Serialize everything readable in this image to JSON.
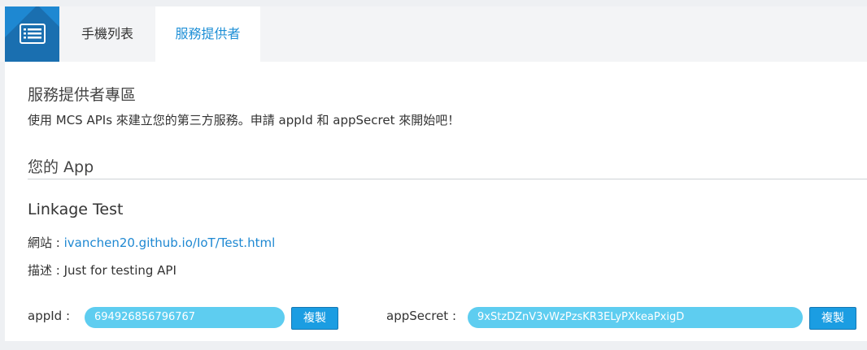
{
  "nav": {
    "logo_icon": "list-icon",
    "tabs": [
      {
        "label": "手機列表",
        "active": false
      },
      {
        "label": "服務提供者",
        "active": true
      }
    ]
  },
  "page": {
    "heading": "服務提供者專區",
    "description": "使用 MCS APIs 來建立您的第三方服務。申請 appId 和 appSecret 來開始吧！",
    "apps_heading": "您的 App"
  },
  "app": {
    "name": "Linkage Test",
    "site_label": "網站 : ",
    "site_url": "ivanchen20.github.io/IoT/Test.html",
    "desc_label": "描述 : ",
    "desc_value": "Just for testing API",
    "appid_label": "appId :",
    "appid_value": "694926856796767",
    "appsecret_label": "appSecret :",
    "appsecret_value": "9xStzDZnV3vWzPzsKR3ELyPXkeaPxigD",
    "copy_label": "複製"
  },
  "colors": {
    "accent": "#1e88d2",
    "pill": "#5ecdf0",
    "button": "#1b9de2"
  }
}
